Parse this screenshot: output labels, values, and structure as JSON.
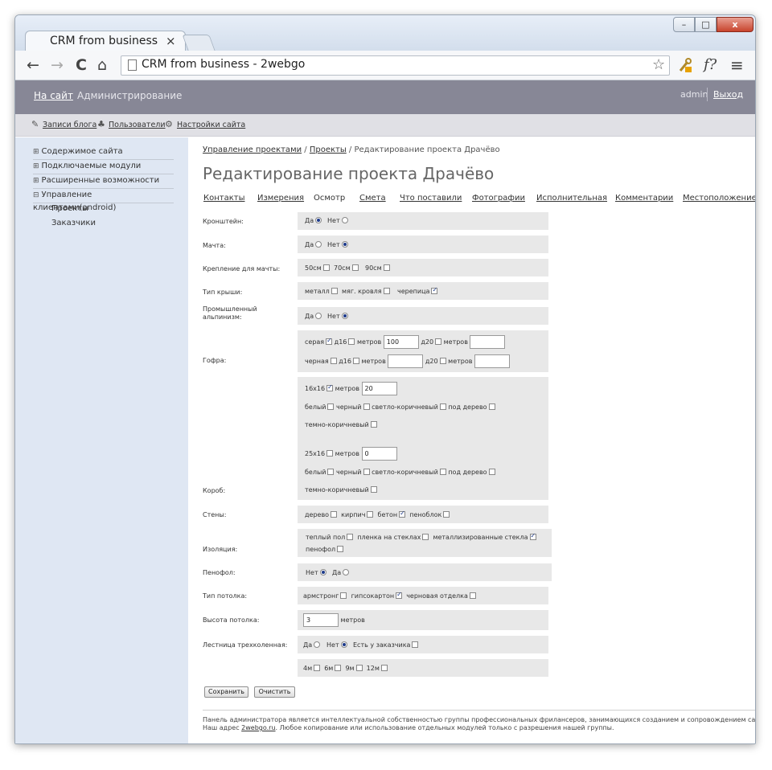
{
  "browser": {
    "tab_title": "CRM from business",
    "tab_close": "×",
    "window_min": "–",
    "window_max": "□",
    "window_close": "x",
    "url": "CRM from business - 2webgo",
    "back": "←",
    "forward": "→",
    "reload": "C",
    "home": "⌂",
    "star": "☆",
    "ext_icon": "f?",
    "menu": "≡"
  },
  "topbar": {
    "site_link": "На сайт",
    "admin_link": "Администрирование",
    "user": "admin",
    "logout": "Выход"
  },
  "subnav": {
    "items": [
      {
        "icon": "pencil-icon",
        "label": "Записи блога"
      },
      {
        "icon": "users-icon",
        "label": "Пользователи"
      },
      {
        "icon": "gear-icon",
        "label": "Настройки сайта"
      }
    ]
  },
  "sidebar": {
    "items": [
      {
        "toggle": "⊞",
        "label": "Содержимое сайта"
      },
      {
        "toggle": "⊞",
        "label": "Подключаемые модули"
      },
      {
        "toggle": "⊞",
        "label": "Расширенные возможности"
      },
      {
        "toggle": "⊟",
        "label": "Управление клиентами(android)"
      }
    ],
    "subitems": [
      "Проекты",
      "Заказчики"
    ]
  },
  "breadcrumb": {
    "link1": "Управление проектами",
    "sep1": " / ",
    "link2": "Проекты",
    "sep2": " / ",
    "current": "Редактирование проекта Драчёво"
  },
  "page_title": "Редактирование проекта Драчёво",
  "tabs": [
    "Контакты",
    "Измерения",
    "Осмотр",
    "Смета",
    "Что поставили",
    "Фотографии",
    "Исполнительная",
    "Комментарии",
    "Местоположение"
  ],
  "active_tab_index": 2,
  "form": {
    "bracket": {
      "label": "Кронштейн:",
      "yes": "Да",
      "no": "Нет",
      "value": "yes"
    },
    "mast": {
      "label": "Мачта:",
      "yes": "Да",
      "no": "Нет",
      "value": "no"
    },
    "mast_mount": {
      "label": "Крепление для мачты:",
      "opt1": "50см",
      "opt2": "70см",
      "opt3": "90см"
    },
    "roof_type": {
      "label": "Тип крыши:",
      "opt1": "металл",
      "opt2": "мяг. кровля",
      "opt3": "черепица",
      "checked": "opt3"
    },
    "alpinism": {
      "label_line1": "Промышленный",
      "label_line2": "альпинизм:",
      "yes": "Да",
      "no": "Нет",
      "value": "no"
    },
    "gofra": {
      "label": "Гофра:",
      "row1": {
        "color": "серая",
        "d16": "д16",
        "meters": "метров",
        "meters_value": "100",
        "d20": "д20",
        "meters2": "метров",
        "meters2_value": ""
      },
      "row2": {
        "color": "черная",
        "d16": "д16",
        "meters": "метров",
        "meters_value": "",
        "d20": "д20",
        "meters2": "метров",
        "meters2_value": ""
      }
    },
    "box": {
      "label": "Короб:",
      "size1": "16x16",
      "size1_meters": "метров",
      "size1_value": "20",
      "size2": "25x16",
      "size2_meters": "метров",
      "size2_value": "0",
      "white": "белый",
      "black": "черный",
      "light_brown": "светло-коричневый",
      "wood": "под дерево",
      "dark_brown": "темно-коричневый"
    },
    "walls": {
      "label": "Стены:",
      "opt1": "дерево",
      "opt2": "кирпич",
      "opt3": "бетон",
      "opt4": "пеноблок",
      "checked": "opt3"
    },
    "insulation": {
      "label": "Изоляция:",
      "opt1": "теплый пол",
      "opt2": "пленка на стеклах",
      "opt3": "металлизированные стекла",
      "opt4": "пенофол",
      "checked": "opt3"
    },
    "penofol": {
      "label": "Пенофол:",
      "no": "Нет",
      "yes": "Да",
      "value": "no"
    },
    "ceiling_type": {
      "label": "Тип потолка:",
      "opt1": "армстронг",
      "opt2": "гипсокартон",
      "opt3": "черновая отделка",
      "checked": "opt2"
    },
    "ceiling_height": {
      "label": "Высота потолка:",
      "value": "3",
      "unit": "метров"
    },
    "stairs": {
      "label": "Лестница трехколенная:",
      "yes": "Да",
      "no": "Нет",
      "value": "no",
      "customer_has": "Есть у заказчика",
      "opt4": "4м",
      "opt6": "6м",
      "opt9": "9м",
      "opt12": "12м"
    }
  },
  "buttons": {
    "save": "Сохранить",
    "clear": "Очистить"
  },
  "footer": {
    "line1": "Панель администратора является интеллектуальной собственностью группы профессиональных фрилансеров, занимающихся созданием и сопровождением сайтов.",
    "line2_prefix": "Наш адрес ",
    "line2_link": "2webgo.ru",
    "line2_suffix": ". Любое копирование или использование отдельных модулей только с разрешения нашей группы."
  }
}
